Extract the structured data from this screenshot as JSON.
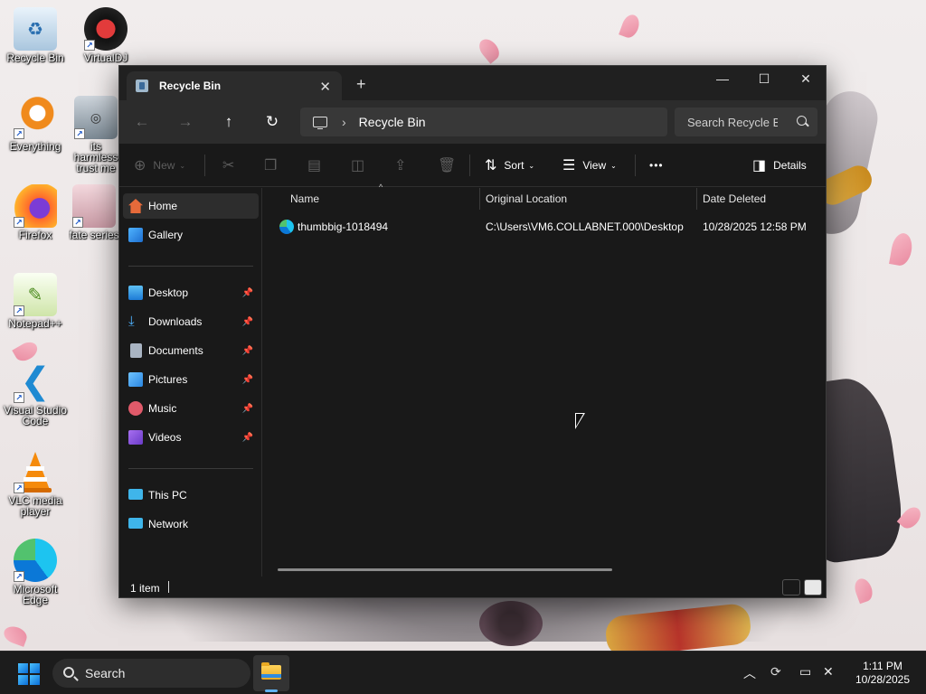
{
  "desktop": {
    "icons": [
      {
        "label": "Recycle Bin"
      },
      {
        "label": "VirtualDJ"
      },
      {
        "label": "Everything"
      },
      {
        "label": "its harmless trust me"
      },
      {
        "label": "Firefox"
      },
      {
        "label": "fate series"
      },
      {
        "label": "Notepad++"
      },
      {
        "label": "Visual Studio Code"
      },
      {
        "label": "VLC media player"
      },
      {
        "label": "Microsoft Edge"
      }
    ]
  },
  "window": {
    "tab_title": "Recycle Bin",
    "tab_close": "✕",
    "new_tab": "+",
    "controls": {
      "minimize": "—",
      "maximize": "☐",
      "close": "✕"
    },
    "nav": {
      "back": "←",
      "forward": "→",
      "up": "↑",
      "refresh": "↻"
    },
    "address": {
      "chevron": "›",
      "location": "Recycle Bin"
    },
    "search": {
      "placeholder": "Search Recycle Bin"
    },
    "toolbar": {
      "new_label": "New",
      "sort_label": "Sort",
      "view_label": "View",
      "more_label": "•••",
      "details_label": "Details"
    },
    "sidebar": {
      "home": "Home",
      "gallery": "Gallery",
      "pinned": [
        "Desktop",
        "Downloads",
        "Documents",
        "Pictures",
        "Music",
        "Videos"
      ],
      "this_pc": "This PC",
      "network": "Network"
    },
    "columns": {
      "name": "Name",
      "original_location": "Original Location",
      "date_deleted": "Date Deleted"
    },
    "files": [
      {
        "name": "thumbbig-1018494",
        "original_location": "C:\\Users\\VM6.COLLABNET.000\\Desktop",
        "date_deleted": "10/28/2025 12:58 PM"
      }
    ],
    "status": {
      "item_count": "1 item"
    }
  },
  "taskbar": {
    "search_label": "Search",
    "time": "1:11 PM",
    "date": "10/28/2025"
  },
  "colors": {
    "window_bg": "#191919",
    "nav_bg": "#2c2c2c",
    "accent": "#4cc2ff"
  }
}
